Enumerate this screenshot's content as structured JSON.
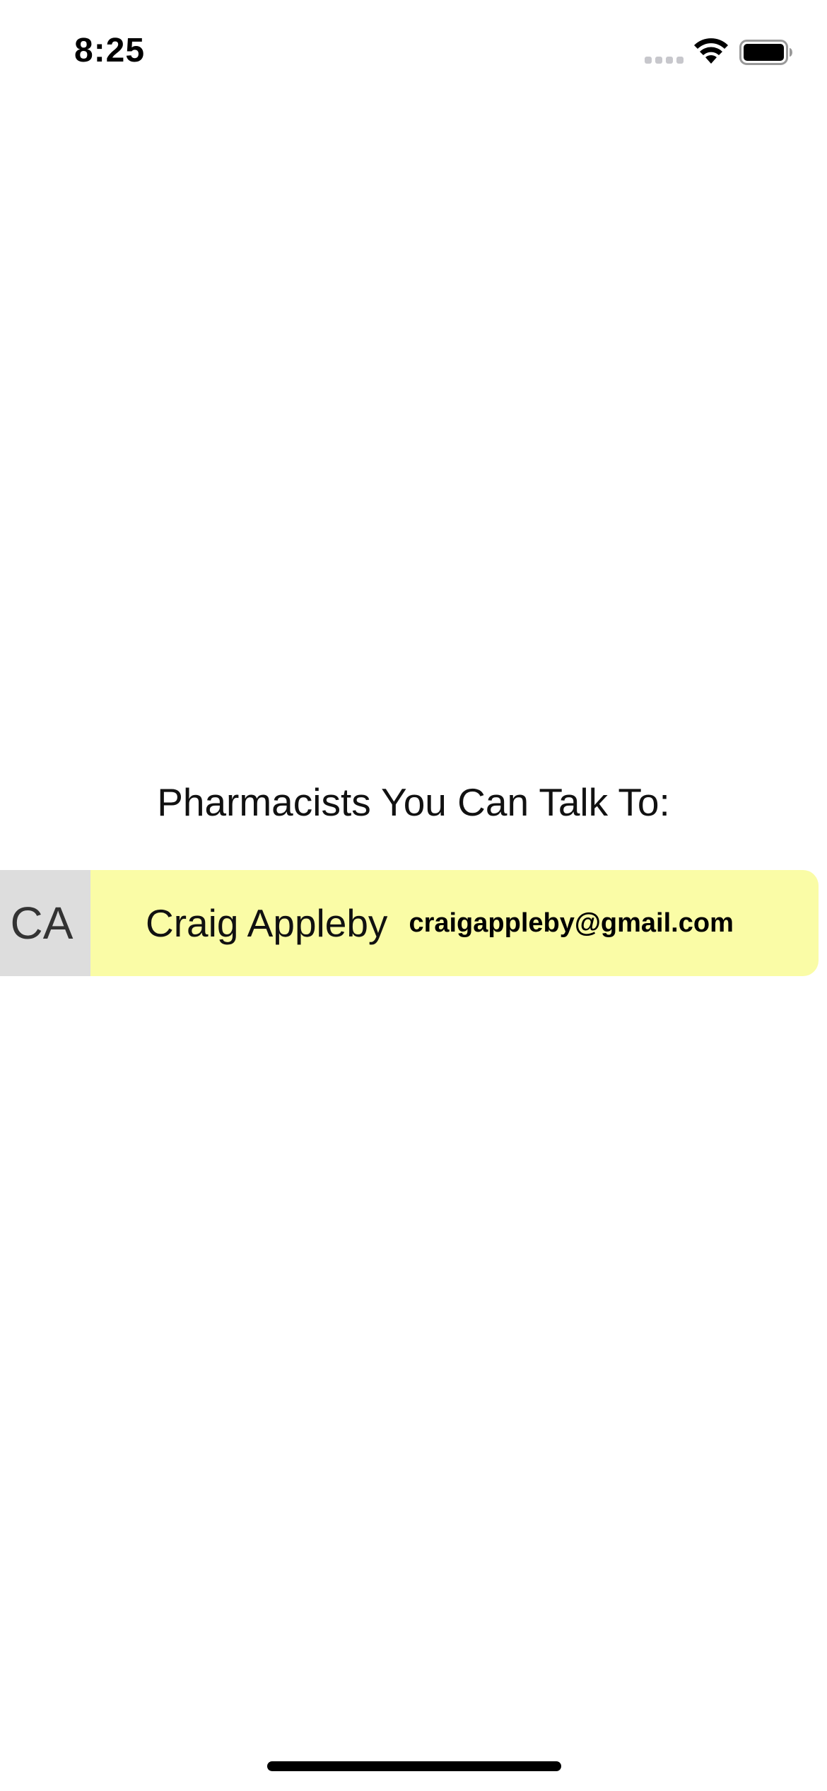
{
  "status_bar": {
    "time": "8:25"
  },
  "main": {
    "section_title": "Pharmacists You Can Talk To:",
    "pharmacists": [
      {
        "initials": "CA",
        "name": "Craig Appleby",
        "email": "craigappleby@gmail.com"
      }
    ]
  },
  "colors": {
    "card_background": "#fafca6",
    "avatar_background": "#dddddd"
  },
  "icons": [
    "signal-icon",
    "wifi-icon",
    "battery-icon"
  ]
}
